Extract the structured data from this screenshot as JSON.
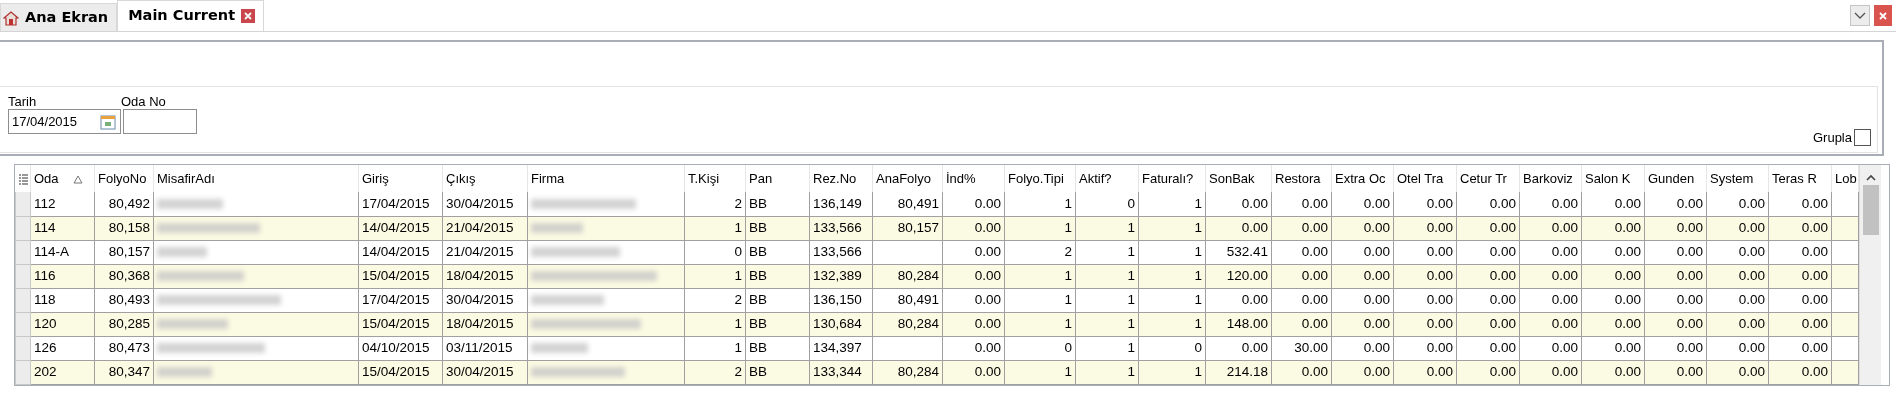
{
  "tabs": [
    {
      "label": "Ana Ekran",
      "kind": "home",
      "selected": false
    },
    {
      "label": "Main Current",
      "kind": "closable",
      "selected": true
    }
  ],
  "filters": {
    "date": {
      "label": "Tarih",
      "value": "17/04/2015"
    },
    "room": {
      "label": "Oda No"
    },
    "group": {
      "label": "Grupla",
      "checked": false
    }
  },
  "table": {
    "columns": [
      {
        "label": "Oda",
        "sorted": true,
        "kind": "text"
      },
      {
        "label": "FolyoNo",
        "kind": "number"
      },
      {
        "label": "MisafirAdı",
        "kind": "blurred"
      },
      {
        "label": "Giriş",
        "kind": "text"
      },
      {
        "label": "Çıkış",
        "kind": "text"
      },
      {
        "label": "Firma",
        "kind": "blurred"
      },
      {
        "label": "T.Kişi",
        "kind": "number"
      },
      {
        "label": "Pan",
        "kind": "text"
      },
      {
        "label": "Rez.No",
        "kind": "text"
      },
      {
        "label": "AnaFolyo",
        "kind": "number"
      },
      {
        "label": "İnd%",
        "kind": "number"
      },
      {
        "label": "Folyo.Tipi",
        "kind": "number"
      },
      {
        "label": "Aktif?",
        "kind": "number"
      },
      {
        "label": "Faturalı?",
        "kind": "number"
      },
      {
        "label": "SonBak",
        "kind": "number"
      },
      {
        "label": "Restora",
        "kind": "number"
      },
      {
        "label": "Extra Oc",
        "kind": "number"
      },
      {
        "label": "Otel Tra",
        "kind": "number"
      },
      {
        "label": "Cetur Tr",
        "kind": "number"
      },
      {
        "label": "Barkoviz",
        "kind": "number"
      },
      {
        "label": "Salon K",
        "kind": "number"
      },
      {
        "label": "Gunden",
        "kind": "number"
      },
      {
        "label": "System",
        "kind": "number"
      },
      {
        "label": "Teras R",
        "kind": "number"
      },
      {
        "label": "Lob",
        "kind": "number"
      }
    ],
    "rows": [
      [
        "112",
        "80,492",
        null,
        "17/04/2015",
        "30/04/2015",
        null,
        "2",
        "BB",
        "136,149",
        "80,491",
        "0.00",
        "1",
        "0",
        "1",
        "0.00",
        "0.00",
        "0.00",
        "0.00",
        "0.00",
        "0.00",
        "0.00",
        "0.00",
        "0.00",
        "0.00",
        null
      ],
      [
        "114",
        "80,158",
        null,
        "14/04/2015",
        "21/04/2015",
        null,
        "1",
        "BB",
        "133,566",
        "80,157",
        "0.00",
        "1",
        "1",
        "1",
        "0.00",
        "0.00",
        "0.00",
        "0.00",
        "0.00",
        "0.00",
        "0.00",
        "0.00",
        "0.00",
        "0.00",
        null
      ],
      [
        "114-A",
        "80,157",
        null,
        "14/04/2015",
        "21/04/2015",
        null,
        "0",
        "BB",
        "133,566",
        null,
        "0.00",
        "2",
        "1",
        "1",
        "532.41",
        "0.00",
        "0.00",
        "0.00",
        "0.00",
        "0.00",
        "0.00",
        "0.00",
        "0.00",
        "0.00",
        null
      ],
      [
        "116",
        "80,368",
        null,
        "15/04/2015",
        "18/04/2015",
        null,
        "1",
        "BB",
        "132,389",
        "80,284",
        "0.00",
        "1",
        "1",
        "1",
        "120.00",
        "0.00",
        "0.00",
        "0.00",
        "0.00",
        "0.00",
        "0.00",
        "0.00",
        "0.00",
        "0.00",
        null
      ],
      [
        "118",
        "80,493",
        null,
        "17/04/2015",
        "30/04/2015",
        null,
        "2",
        "BB",
        "136,150",
        "80,491",
        "0.00",
        "1",
        "1",
        "1",
        "0.00",
        "0.00",
        "0.00",
        "0.00",
        "0.00",
        "0.00",
        "0.00",
        "0.00",
        "0.00",
        "0.00",
        null
      ],
      [
        "120",
        "80,285",
        null,
        "15/04/2015",
        "18/04/2015",
        null,
        "1",
        "BB",
        "130,684",
        "80,284",
        "0.00",
        "1",
        "1",
        "1",
        "148.00",
        "0.00",
        "0.00",
        "0.00",
        "0.00",
        "0.00",
        "0.00",
        "0.00",
        "0.00",
        "0.00",
        null
      ],
      [
        "126",
        "80,473",
        null,
        "04/10/2015",
        "03/11/2015",
        null,
        "1",
        "BB",
        "134,397",
        null,
        "0.00",
        "0",
        "1",
        "0",
        "0.00",
        "30.00",
        "0.00",
        "0.00",
        "0.00",
        "0.00",
        "0.00",
        "0.00",
        "0.00",
        "0.00",
        null
      ],
      [
        "202",
        "80,347",
        null,
        "15/04/2015",
        "30/04/2015",
        null,
        "2",
        "BB",
        "133,344",
        "80,284",
        "0.00",
        "1",
        "1",
        "1",
        "214.18",
        "0.00",
        "0.00",
        "0.00",
        "0.00",
        "0.00",
        "0.00",
        "0.00",
        "0.00",
        "0.00",
        null
      ]
    ]
  }
}
